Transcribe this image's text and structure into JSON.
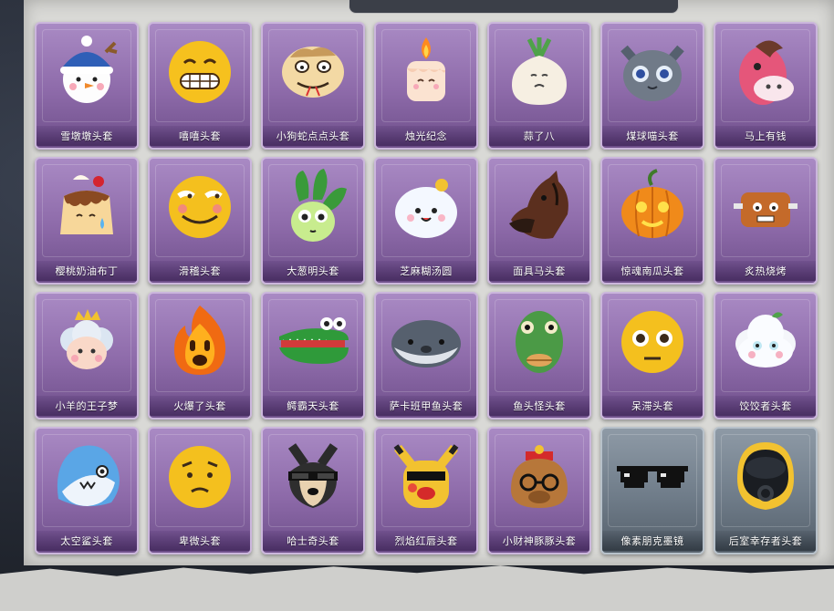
{
  "items": [
    {
      "label": "雪墩墩头套",
      "icon": "snowman-hat-icon",
      "frame": "purple"
    },
    {
      "label": "嘻嘻头套",
      "icon": "grin-face-icon",
      "frame": "purple"
    },
    {
      "label": "小狗蛇点点头套",
      "icon": "snake-head-icon",
      "frame": "purple"
    },
    {
      "label": "烛光纪念",
      "icon": "candle-icon",
      "frame": "purple"
    },
    {
      "label": "蒜了八",
      "icon": "garlic-icon",
      "frame": "purple"
    },
    {
      "label": "煤球喵头套",
      "icon": "gray-cat-icon",
      "frame": "purple"
    },
    {
      "label": "马上有钱",
      "icon": "pink-horse-icon",
      "frame": "purple"
    },
    {
      "label": "樱桃奶油布丁",
      "icon": "pudding-icon",
      "frame": "purple"
    },
    {
      "label": "滑稽头套",
      "icon": "sly-face-icon",
      "frame": "purple"
    },
    {
      "label": "大葱明头套",
      "icon": "green-onion-icon",
      "frame": "purple"
    },
    {
      "label": "芝麻糊汤圆",
      "icon": "rice-ball-icon",
      "frame": "purple"
    },
    {
      "label": "面具马头套",
      "icon": "horse-mask-icon",
      "frame": "purple"
    },
    {
      "label": "惊魂南瓜头套",
      "icon": "pumpkin-icon",
      "frame": "purple"
    },
    {
      "label": "炙热烧烤",
      "icon": "toast-icon",
      "frame": "purple"
    },
    {
      "label": "小羊的王子梦",
      "icon": "sheep-crown-icon",
      "frame": "purple"
    },
    {
      "label": "火爆了头套",
      "icon": "fire-spirit-icon",
      "frame": "purple"
    },
    {
      "label": "鳄霸天头套",
      "icon": "crocodile-icon",
      "frame": "purple"
    },
    {
      "label": "萨卡班甲鱼头套",
      "icon": "fish-icon",
      "frame": "purple"
    },
    {
      "label": "鱼头怪头套",
      "icon": "fish-mask-icon",
      "frame": "purple"
    },
    {
      "label": "呆滞头套",
      "icon": "stare-face-icon",
      "frame": "purple"
    },
    {
      "label": "饺饺者头套",
      "icon": "dumpling-cloud-icon",
      "frame": "purple"
    },
    {
      "label": "太空鲨头套",
      "icon": "shark-icon",
      "frame": "purple"
    },
    {
      "label": "卑微头套",
      "icon": "shy-face-icon",
      "frame": "purple"
    },
    {
      "label": "哈士奇头套",
      "icon": "husky-icon",
      "frame": "purple"
    },
    {
      "label": "烈焰红唇头套",
      "icon": "yellow-lips-icon",
      "frame": "purple"
    },
    {
      "label": "小财神豚豚头套",
      "icon": "capybara-icon",
      "frame": "purple"
    },
    {
      "label": "像素朋克墨镜",
      "icon": "pixel-sunglasses-icon",
      "frame": "gray"
    },
    {
      "label": "后室幸存者头套",
      "icon": "gas-mask-helmet-icon",
      "frame": "gray"
    }
  ]
}
